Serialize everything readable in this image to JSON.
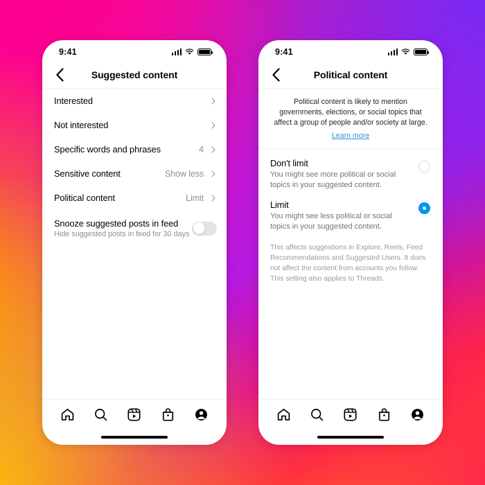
{
  "background": {
    "name": "instagram-gradient",
    "colors": [
      "#FF0090",
      "#6E2CF7",
      "#FFC800",
      "#FF1255",
      "#FF8A00"
    ]
  },
  "accent": {
    "blue": "#0095F6",
    "link": "#2B97D4",
    "muted": "#8E8E8E"
  },
  "statusbar": {
    "time": "9:41",
    "icons": [
      "signal-icon",
      "wifi-icon",
      "battery-icon"
    ]
  },
  "phone_left": {
    "header": {
      "title": "Suggested content",
      "back_icon": "chevron-left-icon"
    },
    "rows": [
      {
        "label": "Interested",
        "value": "",
        "chevron": "chevron-right-icon"
      },
      {
        "label": "Not interested",
        "value": "",
        "chevron": "chevron-right-icon"
      },
      {
        "label": "Specific words and phrases",
        "value": "4",
        "chevron": "chevron-right-icon"
      },
      {
        "label": "Sensitive content",
        "value": "Show less",
        "chevron": "chevron-right-icon"
      },
      {
        "label": "Political content",
        "value": "Limit",
        "chevron": "chevron-right-icon"
      }
    ],
    "toggle_row": {
      "title": "Snooze suggested posts in feed",
      "subtitle": "Hide suggested posts in feed for 30 days",
      "state": "off"
    }
  },
  "phone_right": {
    "header": {
      "title": "Political content",
      "back_icon": "chevron-left-icon"
    },
    "description": "Political content is likely to mention governments, elections, or social topics that affect a group of people and/or society at large.",
    "learn_more": "Learn more",
    "options": [
      {
        "title": "Don't limit",
        "subtitle": "You might see more political or social topics in your suggested content.",
        "selected": false
      },
      {
        "title": "Limit",
        "subtitle": "You might see less political or social topics in your suggested content.",
        "selected": true
      }
    ],
    "footnote": "This affects suggestions in Explore, Reels, Feed Recommendations and Suggested Users. It does not affect the content from accounts you follow. This setting also applies to Threads."
  },
  "tabbar": {
    "items": [
      "home-icon",
      "search-icon",
      "reels-icon",
      "shop-icon",
      "profile-icon"
    ]
  }
}
